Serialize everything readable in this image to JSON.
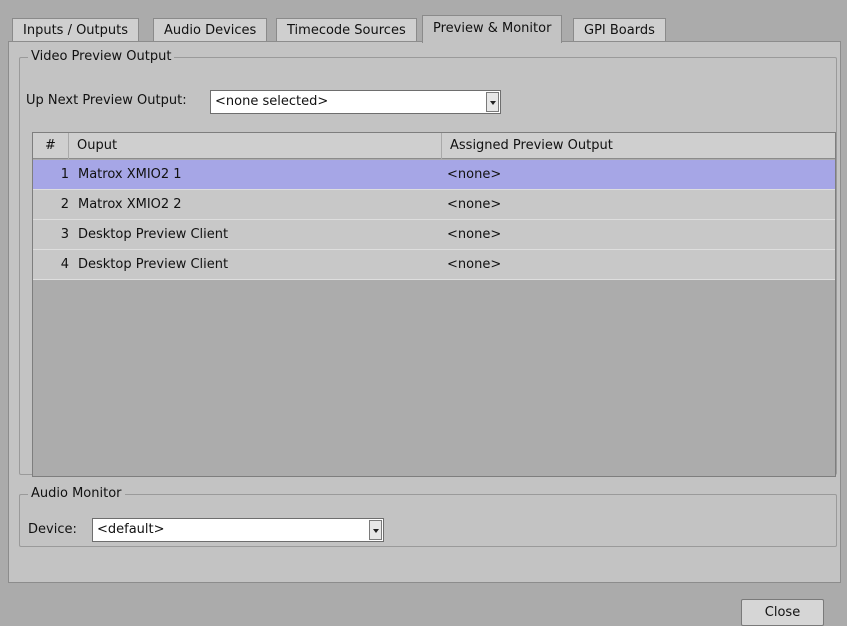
{
  "tabs": [
    {
      "label": "Inputs / Outputs"
    },
    {
      "label": "Audio Devices"
    },
    {
      "label": "Timecode Sources"
    },
    {
      "label": "Preview & Monitor"
    },
    {
      "label": "GPI Boards"
    }
  ],
  "active_tab": "Preview & Monitor",
  "video_preview": {
    "legend": "Video Preview Output",
    "up_next_label": "Up Next Preview Output:",
    "up_next_value": "<none selected>",
    "table": {
      "headers": {
        "num": "#",
        "output": "Ouput",
        "assigned": "Assigned Preview Output"
      },
      "rows": [
        {
          "num": "1",
          "output": "Matrox XMIO2 1",
          "assigned": "<none>",
          "selected": true
        },
        {
          "num": "2",
          "output": "Matrox XMIO2 2",
          "assigned": "<none>",
          "selected": false
        },
        {
          "num": "3",
          "output": "Desktop Preview Client",
          "assigned": "<none>",
          "selected": false
        },
        {
          "num": "4",
          "output": "Desktop Preview Client",
          "assigned": "<none>",
          "selected": false
        }
      ]
    }
  },
  "audio_monitor": {
    "legend": "Audio Monitor",
    "device_label": "Device:",
    "device_value": "<default>"
  },
  "footer": {
    "close_label": "Close"
  },
  "icons": {
    "dropdown": "chevron-down-icon"
  },
  "colors": {
    "selected_row": "#a6a6e6",
    "background": "#ababab"
  }
}
